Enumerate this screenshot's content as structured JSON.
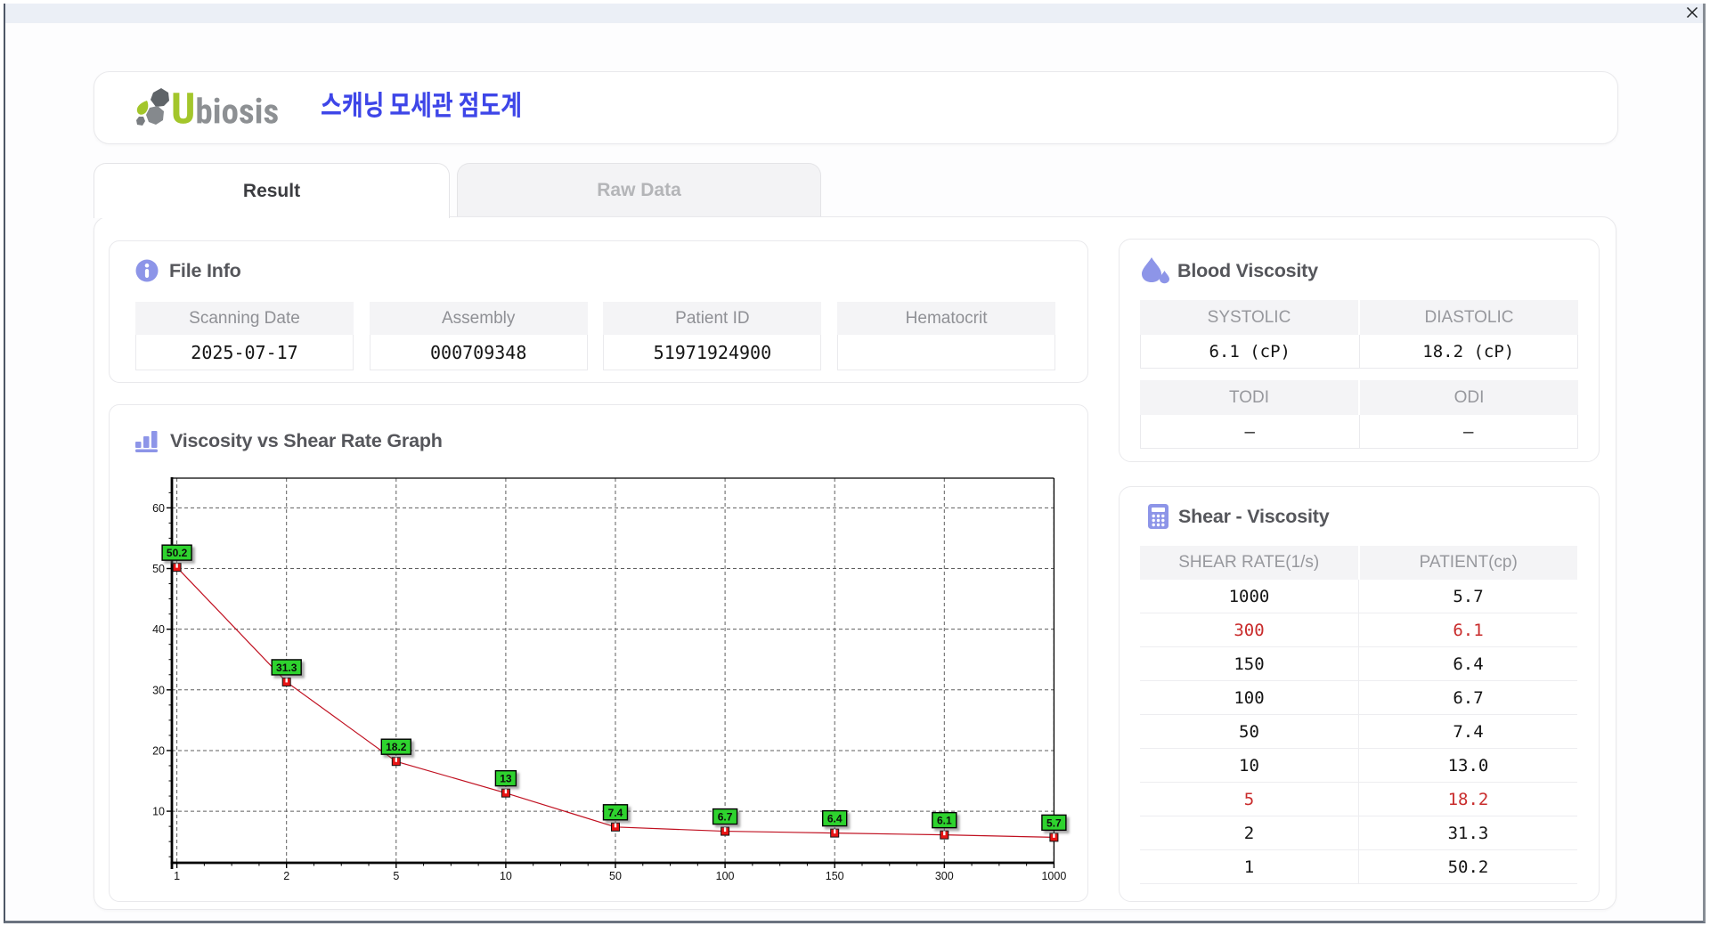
{
  "window": {
    "close_icon": "close"
  },
  "brand": {
    "name": "Ubiosis",
    "logo_u": "U",
    "logo_rest": "biosis",
    "korean_title": "스캐닝 모세관 점도계",
    "accent_green": "#a3c62b",
    "logo_gray": "#8d9093",
    "title_blue": "#3e46e8"
  },
  "tabs": [
    {
      "label": "Result",
      "active": true
    },
    {
      "label": "Raw Data",
      "active": false
    }
  ],
  "file_info": {
    "title": "File Info",
    "fields": [
      {
        "label": "Scanning Date",
        "value": "2025-07-17"
      },
      {
        "label": "Assembly",
        "value": "000709348"
      },
      {
        "label": "Patient ID",
        "value": "51971924900"
      },
      {
        "label": "Hematocrit",
        "value": ""
      }
    ]
  },
  "graph": {
    "title": "Viscosity vs Shear Rate Graph"
  },
  "chart_data": {
    "type": "line",
    "title": "Viscosity vs Shear Rate Graph",
    "x_categories": [
      "1",
      "2",
      "5",
      "10",
      "50",
      "100",
      "150",
      "300",
      "1000"
    ],
    "values": [
      50.2,
      31.3,
      18.2,
      13,
      7.4,
      6.7,
      6.4,
      6.1,
      5.7
    ],
    "point_labels": [
      "50.2",
      "31.3",
      "18.2",
      "13",
      "7.4",
      "6.7",
      "6.4",
      "6.1",
      "5.7"
    ],
    "y_ticks": [
      10,
      20,
      30,
      40,
      50,
      60
    ],
    "ylim": [
      1.5,
      64.9
    ],
    "xlabel": "",
    "ylabel": "",
    "grid": "dashed",
    "x_scale": "categorical",
    "legend": "none",
    "line_color": "#c01020",
    "marker_color": "#e81414",
    "label_bg": "#2ed32e"
  },
  "blood_viscosity": {
    "title": "Blood Viscosity",
    "rows": [
      {
        "label1": "SYSTOLIC",
        "value1": "6.1 (cP)",
        "label2": "DIASTOLIC",
        "value2": "18.2 (cP)"
      },
      {
        "label1": "TODI",
        "value1": "–",
        "label2": "ODI",
        "value2": "–"
      }
    ]
  },
  "shear_table": {
    "title": "Shear - Viscosity",
    "headers": [
      "SHEAR RATE(1/s)",
      "PATIENT(cp)"
    ],
    "rows": [
      {
        "rate": "1000",
        "patient": "5.7",
        "highlight": false
      },
      {
        "rate": "300",
        "patient": "6.1",
        "highlight": true
      },
      {
        "rate": "150",
        "patient": "6.4",
        "highlight": false
      },
      {
        "rate": "100",
        "patient": "6.7",
        "highlight": false
      },
      {
        "rate": "50",
        "patient": "7.4",
        "highlight": false
      },
      {
        "rate": "10",
        "patient": "13.0",
        "highlight": false
      },
      {
        "rate": "5",
        "patient": "18.2",
        "highlight": true
      },
      {
        "rate": "2",
        "patient": "31.3",
        "highlight": false
      },
      {
        "rate": "1",
        "patient": "50.2",
        "highlight": false
      }
    ]
  }
}
